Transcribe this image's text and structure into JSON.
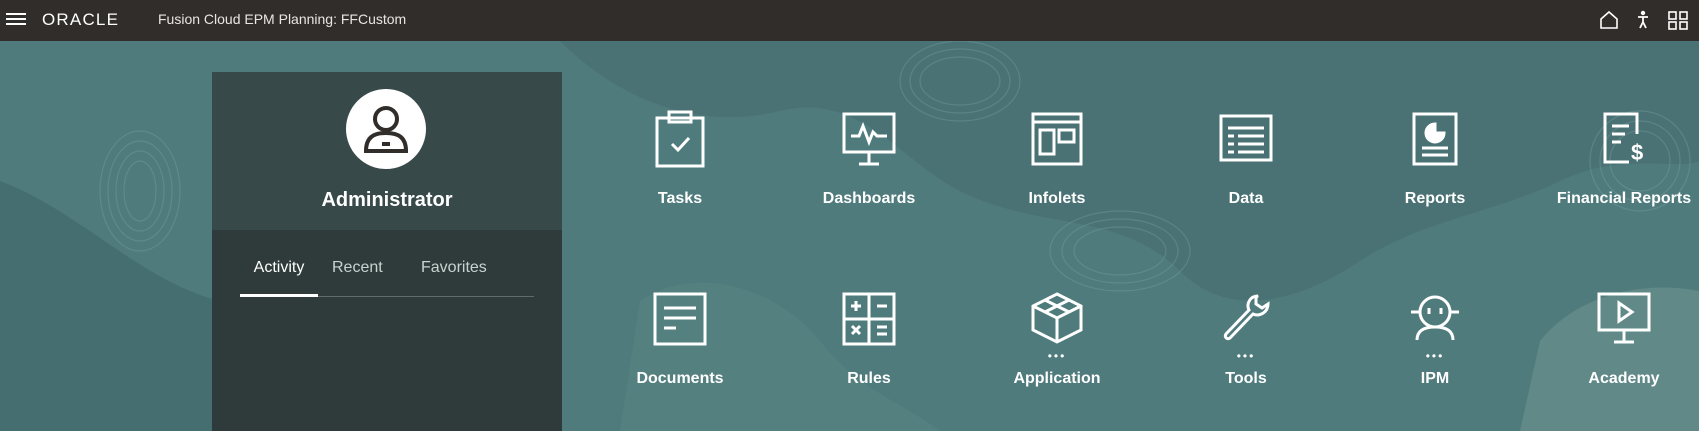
{
  "header": {
    "logo": "ORACLE",
    "app_title": "Fusion Cloud EPM Planning:  FFCustom",
    "icons": [
      "menu-icon",
      "home-icon",
      "accessibility-icon",
      "navigator-grid-icon"
    ]
  },
  "user_panel": {
    "name": "Administrator",
    "avatar_icon": "user-avatar-icon",
    "tabs": [
      {
        "label": "Activity",
        "active": true
      },
      {
        "label": "Recent",
        "active": false
      },
      {
        "label": "Favorites",
        "active": false
      }
    ]
  },
  "tiles": [
    {
      "label": "Tasks",
      "icon": "clipboard-check-icon"
    },
    {
      "label": "Dashboards",
      "icon": "monitor-chart-icon"
    },
    {
      "label": "Infolets",
      "icon": "infolets-icon"
    },
    {
      "label": "Data",
      "icon": "data-form-icon"
    },
    {
      "label": "Reports",
      "icon": "report-icon"
    },
    {
      "label": "Financial Reports",
      "icon": "financial-report-icon"
    },
    {
      "label": "Documents",
      "icon": "document-icon"
    },
    {
      "label": "Rules",
      "icon": "calculator-icon"
    },
    {
      "label": "Application",
      "icon": "cube-icon"
    },
    {
      "label": "Tools",
      "icon": "wrench-icon"
    },
    {
      "label": "IPM",
      "icon": "ipm-robot-icon"
    },
    {
      "label": "Academy",
      "icon": "video-play-icon"
    }
  ],
  "colors": {
    "topbar": "#312d2a",
    "background": "#4f7b7d",
    "panel": "#2e3b3a"
  }
}
